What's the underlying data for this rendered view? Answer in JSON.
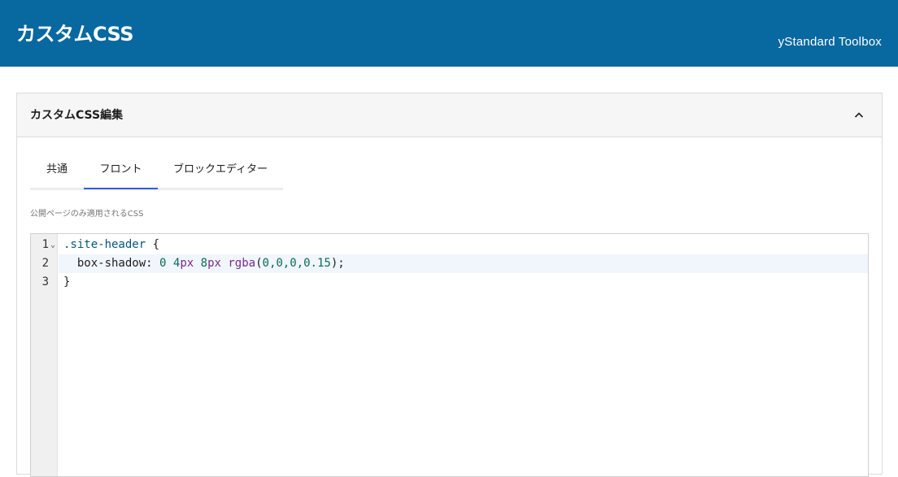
{
  "header": {
    "title": "カスタムCSS",
    "brand": "yStandard Toolbox"
  },
  "panel": {
    "title": "カスタムCSS編集",
    "collapse_icon": "chevron-up-icon"
  },
  "tabs": [
    {
      "label": "共通",
      "active": false
    },
    {
      "label": "フロント",
      "active": true
    },
    {
      "label": "ブロックエディター",
      "active": false
    }
  ],
  "description": "公開ページのみ適用されるCSS",
  "editor": {
    "line_numbers": [
      "1",
      "2",
      "3"
    ],
    "fold_marker": "⌄",
    "lines": {
      "l1_selector": ".site-header",
      "l1_brace": " {",
      "l2_indent": "  ",
      "l2_property": "box-shadow: ",
      "l2_n1": "0",
      "l2_n2": "4",
      "l2_u2": "px",
      "l2_n3": "8",
      "l2_u3": "px",
      "l2_fn": "rgba",
      "l2_args_open": "(",
      "l2_args": "0,0,0,0.15",
      "l2_args_close": ");",
      "l3_brace": "}"
    }
  },
  "colors": {
    "topbar": "#0868a0",
    "active_tab_underline": "#3858e9",
    "active_line_bg": "#f0f6fc"
  }
}
